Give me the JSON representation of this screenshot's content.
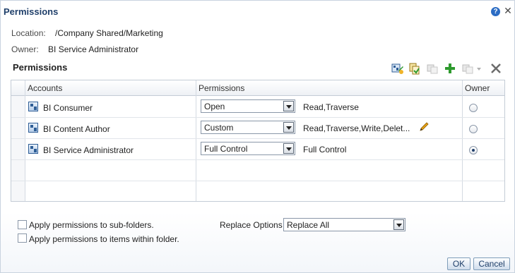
{
  "dialog": {
    "title": "Permissions",
    "help_icon": "?",
    "close_icon": "✕"
  },
  "info": {
    "location_label": "Location:",
    "location_value": "/Company Shared/Marketing",
    "owner_label": "Owner:",
    "owner_value": "BI Service Administrator"
  },
  "section": {
    "title": "Permissions",
    "toolbar_icons": [
      "add-users-roles-icon",
      "copy-permissions-icon",
      "paste-permissions-icon",
      "add-icon",
      "move-menu-icon",
      "delete-icon"
    ]
  },
  "grid": {
    "headers": {
      "accounts": "Accounts",
      "permissions": "Permissions",
      "owner": "Owner"
    },
    "rows": [
      {
        "account": "BI Consumer",
        "permission": "Open",
        "permission_detail": "Read,Traverse",
        "owner": false,
        "editable": false
      },
      {
        "account": "BI Content Author",
        "permission": "Custom",
        "permission_detail": "Read,Traverse,Write,Delet...",
        "owner": false,
        "editable": true
      },
      {
        "account": "BI Service Administrator",
        "permission": "Full Control",
        "permission_detail": "Full Control",
        "owner": true,
        "editable": false
      }
    ]
  },
  "options": {
    "apply_subfolders": "Apply permissions to sub-folders.",
    "apply_items": "Apply permissions to items within folder.",
    "replace_label": "Replace Options",
    "replace_value": "Replace All"
  },
  "buttons": {
    "ok": "OK",
    "cancel": "Cancel"
  },
  "colors": {
    "title": "#1f3f6a",
    "accent": "#2b6cc4",
    "add_green": "#2e9a2e"
  }
}
